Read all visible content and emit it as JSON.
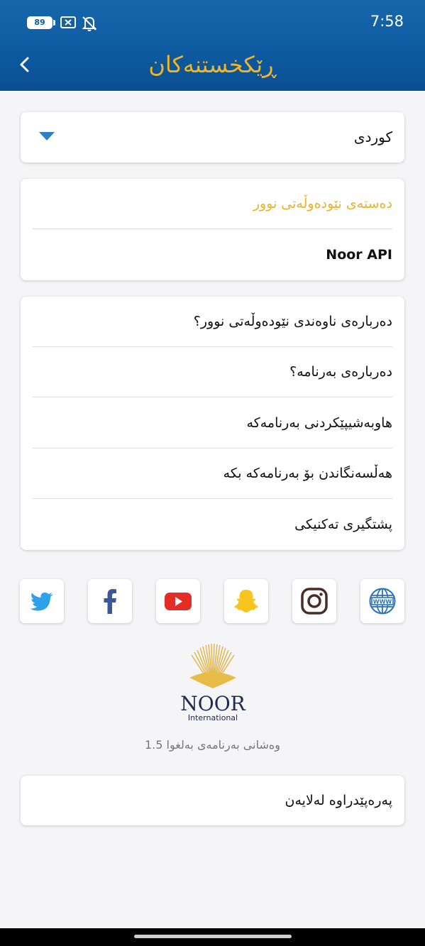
{
  "status": {
    "battery": "89",
    "time": "7:58"
  },
  "header": {
    "title": "ڕێکخستنەکان",
    "back_icon": "chevron-left-icon"
  },
  "language": {
    "selected": "كوردی"
  },
  "group_one": {
    "items": [
      "دەستەی نێودەوڵەتی نوور",
      "Noor API"
    ]
  },
  "group_two": {
    "items": [
      "دەربارەی ناوەندی نێودەوڵەتی نوور؟",
      "دەربارەی بەرنامە؟",
      "هاوبەشیپێکردنی بەرنامەکە",
      "هەڵسەنگاندن بۆ بەرنامەکە بکە",
      "پشتگیری تەکنیکی"
    ]
  },
  "social": [
    "twitter-icon",
    "facebook-icon",
    "youtube-icon",
    "snapchat-icon",
    "instagram-icon",
    "website-icon"
  ],
  "logo": {
    "name": "NOOR",
    "sub": "International"
  },
  "version": "وەشانی بەرنامەی بەلغوا 1.5",
  "sponsor": {
    "label": "پەرەپێدراوە لەلایەن"
  },
  "colors": {
    "header": "#0d5aa0",
    "accent_gold": "#f2b527",
    "caret_blue": "#2d7fc6"
  }
}
